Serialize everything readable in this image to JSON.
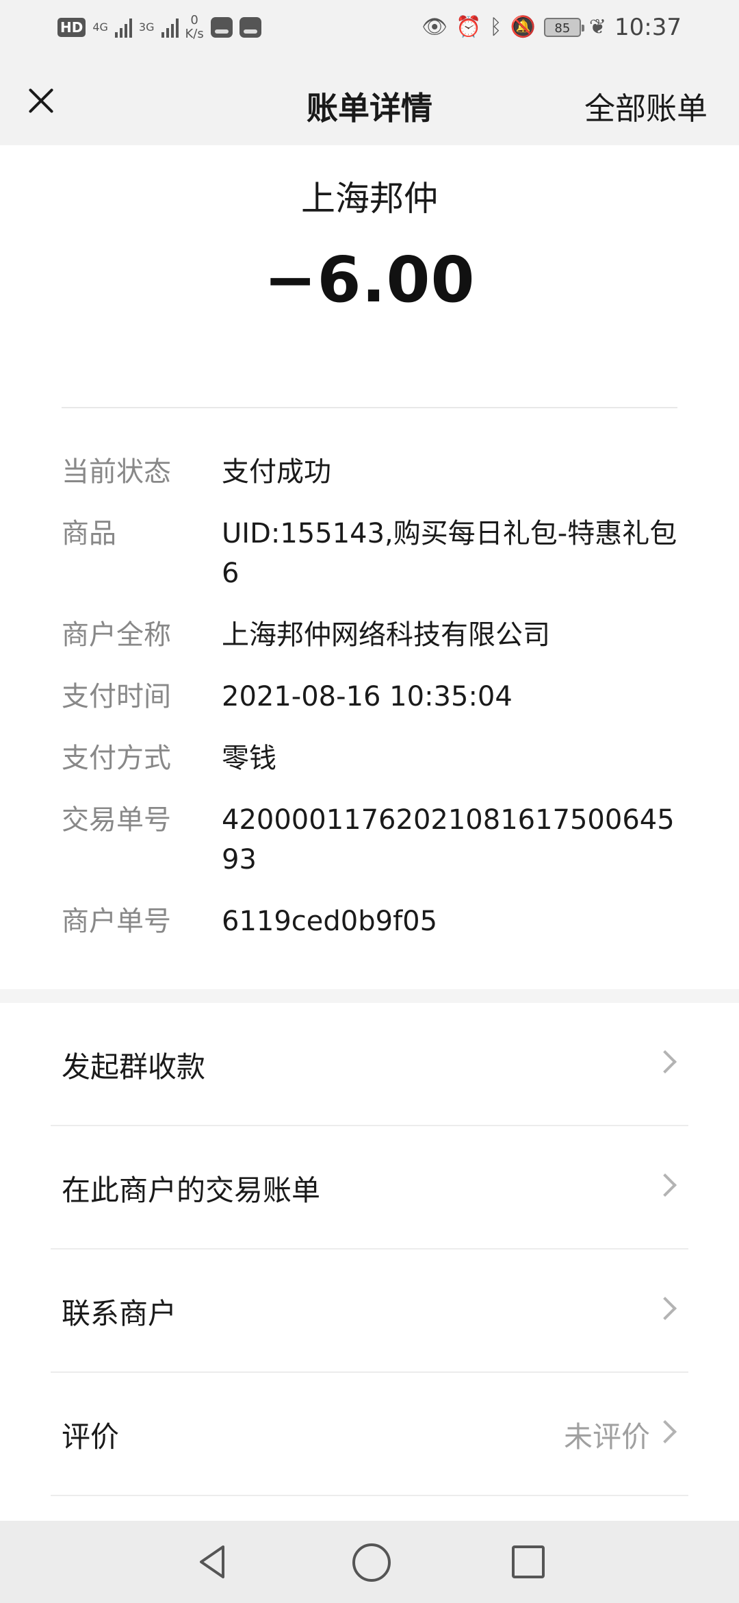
{
  "status_bar": {
    "hd_label": "HD",
    "net_4g": "4G",
    "net_3g": "3G",
    "speed_value": "0",
    "speed_unit": "K/s",
    "battery": "85",
    "time": "10:37"
  },
  "nav": {
    "title": "账单详情",
    "right_link": "全部账单"
  },
  "header": {
    "merchant": "上海邦仲",
    "amount": "−6.00"
  },
  "details": [
    {
      "label": "当前状态",
      "value": "支付成功"
    },
    {
      "label": "商品",
      "value": "UID:155143,购买每日礼包-特惠礼包6"
    },
    {
      "label": "商户全称",
      "value": "上海邦仲网络科技有限公司"
    },
    {
      "label": "支付时间",
      "value": "2021-08-16 10:35:04"
    },
    {
      "label": "支付方式",
      "value": "零钱"
    },
    {
      "label": "交易单号",
      "value": "4200001176202108161750064593"
    },
    {
      "label": "商户单号",
      "value": "6119ced0b9f05"
    }
  ],
  "actions": [
    {
      "label": "发起群收款"
    },
    {
      "label": "在此商户的交易账单"
    },
    {
      "label": "联系商户"
    },
    {
      "label": "评价",
      "value": "未评价"
    }
  ]
}
